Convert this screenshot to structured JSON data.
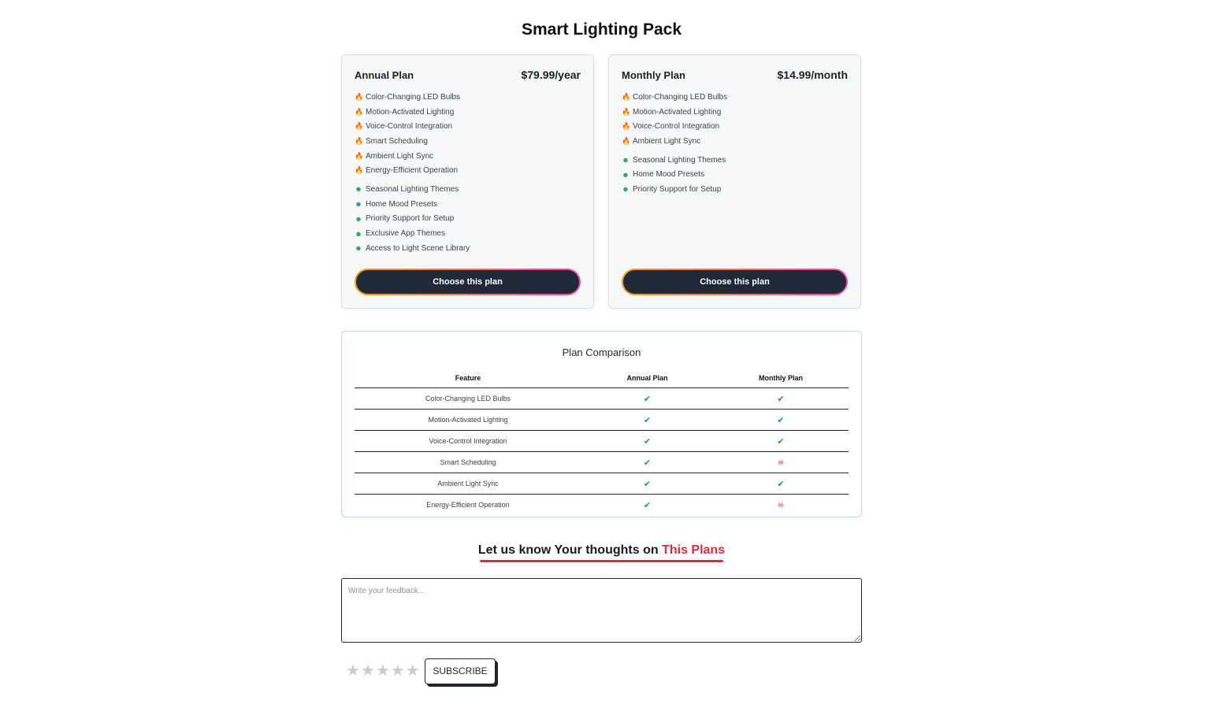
{
  "page": {
    "title": "Smart Lighting Pack"
  },
  "plans": [
    {
      "name": "Annual Plan",
      "price": "$79.99/year",
      "features": [
        "Color-Changing LED Bulbs",
        "Motion-Activated Lighting",
        "Voice-Control Integration",
        "Smart Scheduling",
        "Ambient Light Sync",
        "Energy-Efficient Operation"
      ],
      "extras": [
        "Seasonal Lighting Themes",
        "Home Mood Presets",
        "Priority Support for Setup",
        "Exclusive App Themes",
        "Access to Light Scene Library"
      ],
      "button_label": "Choose this plan"
    },
    {
      "name": "Monthly Plan",
      "price": "$14.99/month",
      "features": [
        "Color-Changing LED Bulbs",
        "Motion-Activated Lighting",
        "Voice-Control Integration",
        "Ambient Light Sync"
      ],
      "extras": [
        "Seasonal Lighting Themes",
        "Home Mood Presets",
        "Priority Support for Setup"
      ],
      "button_label": "Choose this plan"
    }
  ],
  "comparison": {
    "title": "Plan Comparison",
    "headers": [
      "Feature",
      "Annual Plan",
      "Monthly Plan"
    ],
    "rows": [
      {
        "feature": "Color-Changing LED Bulbs",
        "annual": true,
        "monthly": true
      },
      {
        "feature": "Motion-Activated Lighting",
        "annual": true,
        "monthly": true
      },
      {
        "feature": "Voice-Control Integration",
        "annual": true,
        "monthly": true
      },
      {
        "feature": "Smart Scheduling",
        "annual": true,
        "monthly": false
      },
      {
        "feature": "Ambient Light Sync",
        "annual": true,
        "monthly": true
      },
      {
        "feature": "Energy-Efficient Operation",
        "annual": true,
        "monthly": false
      }
    ]
  },
  "feedback": {
    "heading_prefix": "Let us know Your thoughts on",
    "heading_accent": "This Plans",
    "placeholder": "Write your feedback...",
    "rating": 0,
    "rating_max": 5,
    "subscribe_label": "SUBSCRIBE"
  },
  "icons": {
    "feature": "flame-icon",
    "extra": "smile-icon",
    "included": "check-icon",
    "excluded": "skull-icon",
    "rating": "star-icon"
  },
  "colors": {
    "accent": "#e0293d",
    "button_dark": "#202938",
    "check": "#16a34a",
    "cross": "#dc2626",
    "flame": "#ea580c"
  }
}
